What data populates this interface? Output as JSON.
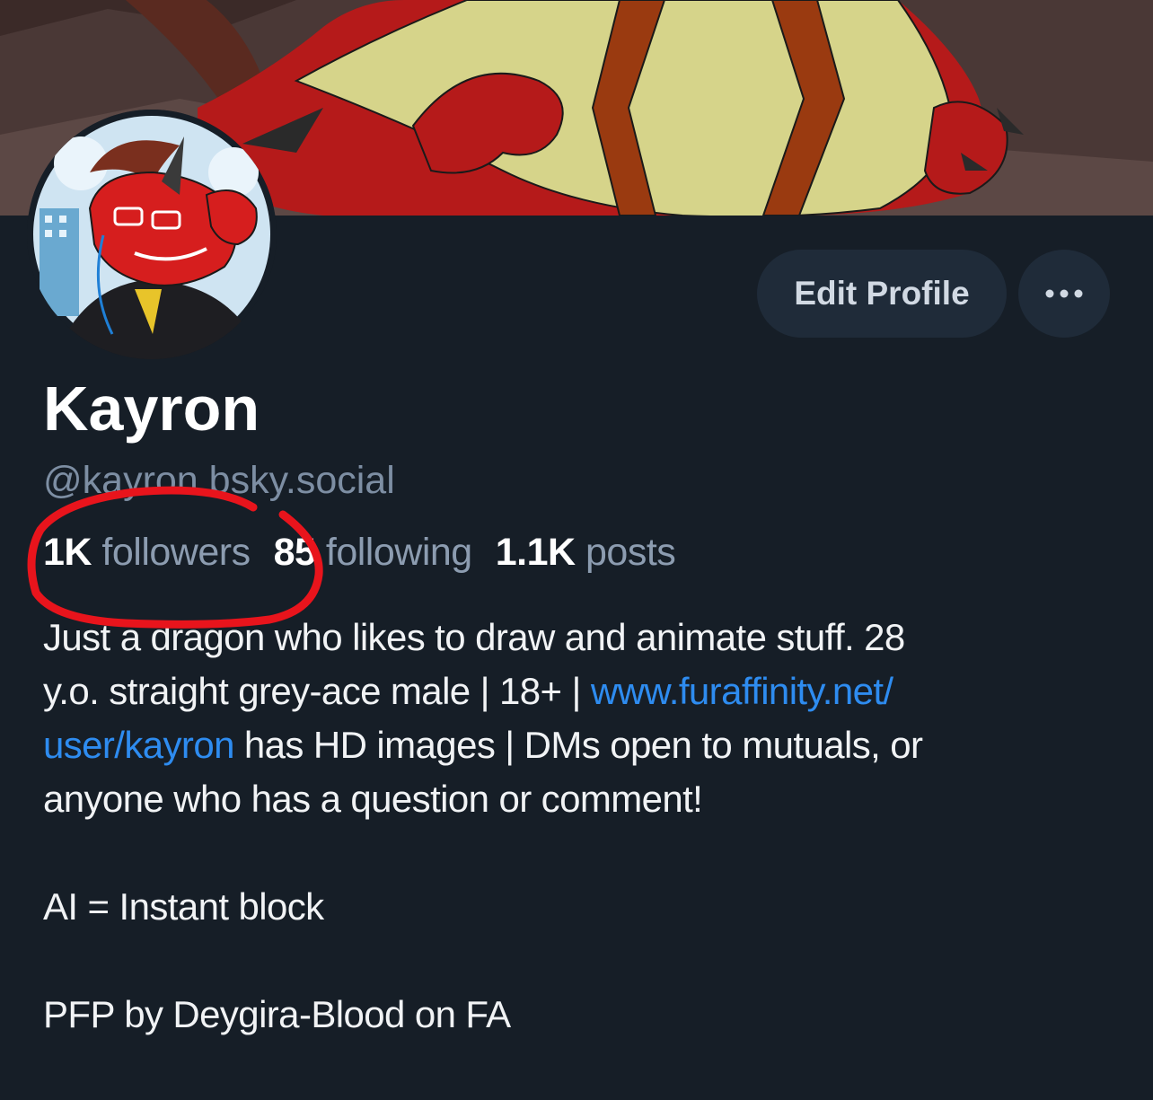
{
  "profile": {
    "display_name": "Kayron",
    "handle": "@kayron.bsky.social",
    "edit_profile_label": "Edit Profile",
    "more_icon": "ellipsis-icon"
  },
  "stats": {
    "followers_count": "1K",
    "followers_label": "followers",
    "following_count": "85",
    "following_label": "following",
    "posts_count": "1.1K",
    "posts_label": "posts"
  },
  "bio": {
    "line1": "Just a dragon who likes to draw and animate stuff. 28",
    "line2_text": "y.o. straight grey-ace male | 18+ | ",
    "line2_link": "www.furaffinity.net/",
    "line3_link": "user/kayron",
    "line3_text": " has HD images | DMs open to mutuals, or",
    "line4": "anyone who has a question or comment!",
    "line5": "AI = Instant block",
    "line6": "PFP by Deygira-Blood on FA"
  },
  "colors": {
    "background": "#161e27",
    "link": "#2e8cf0",
    "muted_text": "#7d8ea3",
    "button_bg": "#1f2b39",
    "annotation_red": "#e8141c"
  }
}
